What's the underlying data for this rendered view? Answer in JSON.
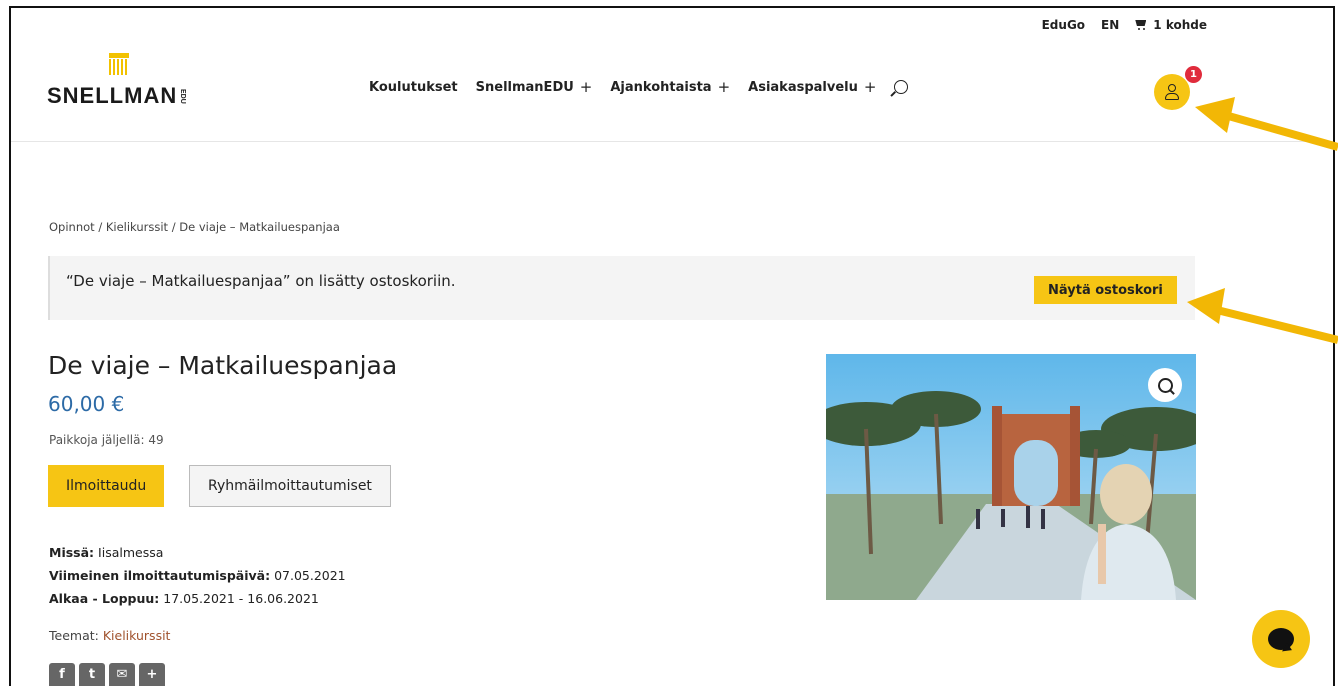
{
  "topbar": {
    "edugo": "EduGo",
    "lang": "EN",
    "cart_label": "1 kohde"
  },
  "logo": {
    "text": "SNELLMAN",
    "suffix": "EDU"
  },
  "nav": {
    "items": [
      {
        "label": "Koulutukset",
        "has_plus": false
      },
      {
        "label": "SnellmanEDU",
        "has_plus": true
      },
      {
        "label": "Ajankohtaista",
        "has_plus": true
      },
      {
        "label": "Asiakaspalvelu",
        "has_plus": true
      }
    ],
    "plus_glyph": "+"
  },
  "user": {
    "badge_count": "1"
  },
  "breadcrumb": "Opinnot / Kielikurssit / De viaje – Matkailuespanjaa",
  "notice": {
    "text": "“De viaje – Matkailuespanjaa” on lisätty ostoskoriin.",
    "button": "Näytä ostoskori"
  },
  "product": {
    "title": "De viaje – Matkailuespanjaa",
    "price": "60,00 €",
    "seats": "Paikkoja jäljellä: 49",
    "primary_button": "Ilmoittaudu",
    "secondary_button": "Ryhmäilmoittautumiset",
    "where_label": "Missä:",
    "where_value": "Iisalmessa",
    "deadline_label": "Viimeinen ilmoittautumispäivä:",
    "deadline_value": "07.05.2021",
    "dates_label": "Alkaa - Loppuu:",
    "dates_value": "17.05.2021 - 16.06.2021",
    "themes_label": "Teemat:",
    "themes_value": "Kielikurssit"
  },
  "share": {
    "facebook": "f",
    "twitter": "t",
    "email": "✉",
    "more": "+"
  },
  "colors": {
    "accent": "#f6c514",
    "price": "#2c6aa6",
    "link": "#a0522d",
    "badge": "#e02b3c",
    "arrow": "#f2b705"
  }
}
